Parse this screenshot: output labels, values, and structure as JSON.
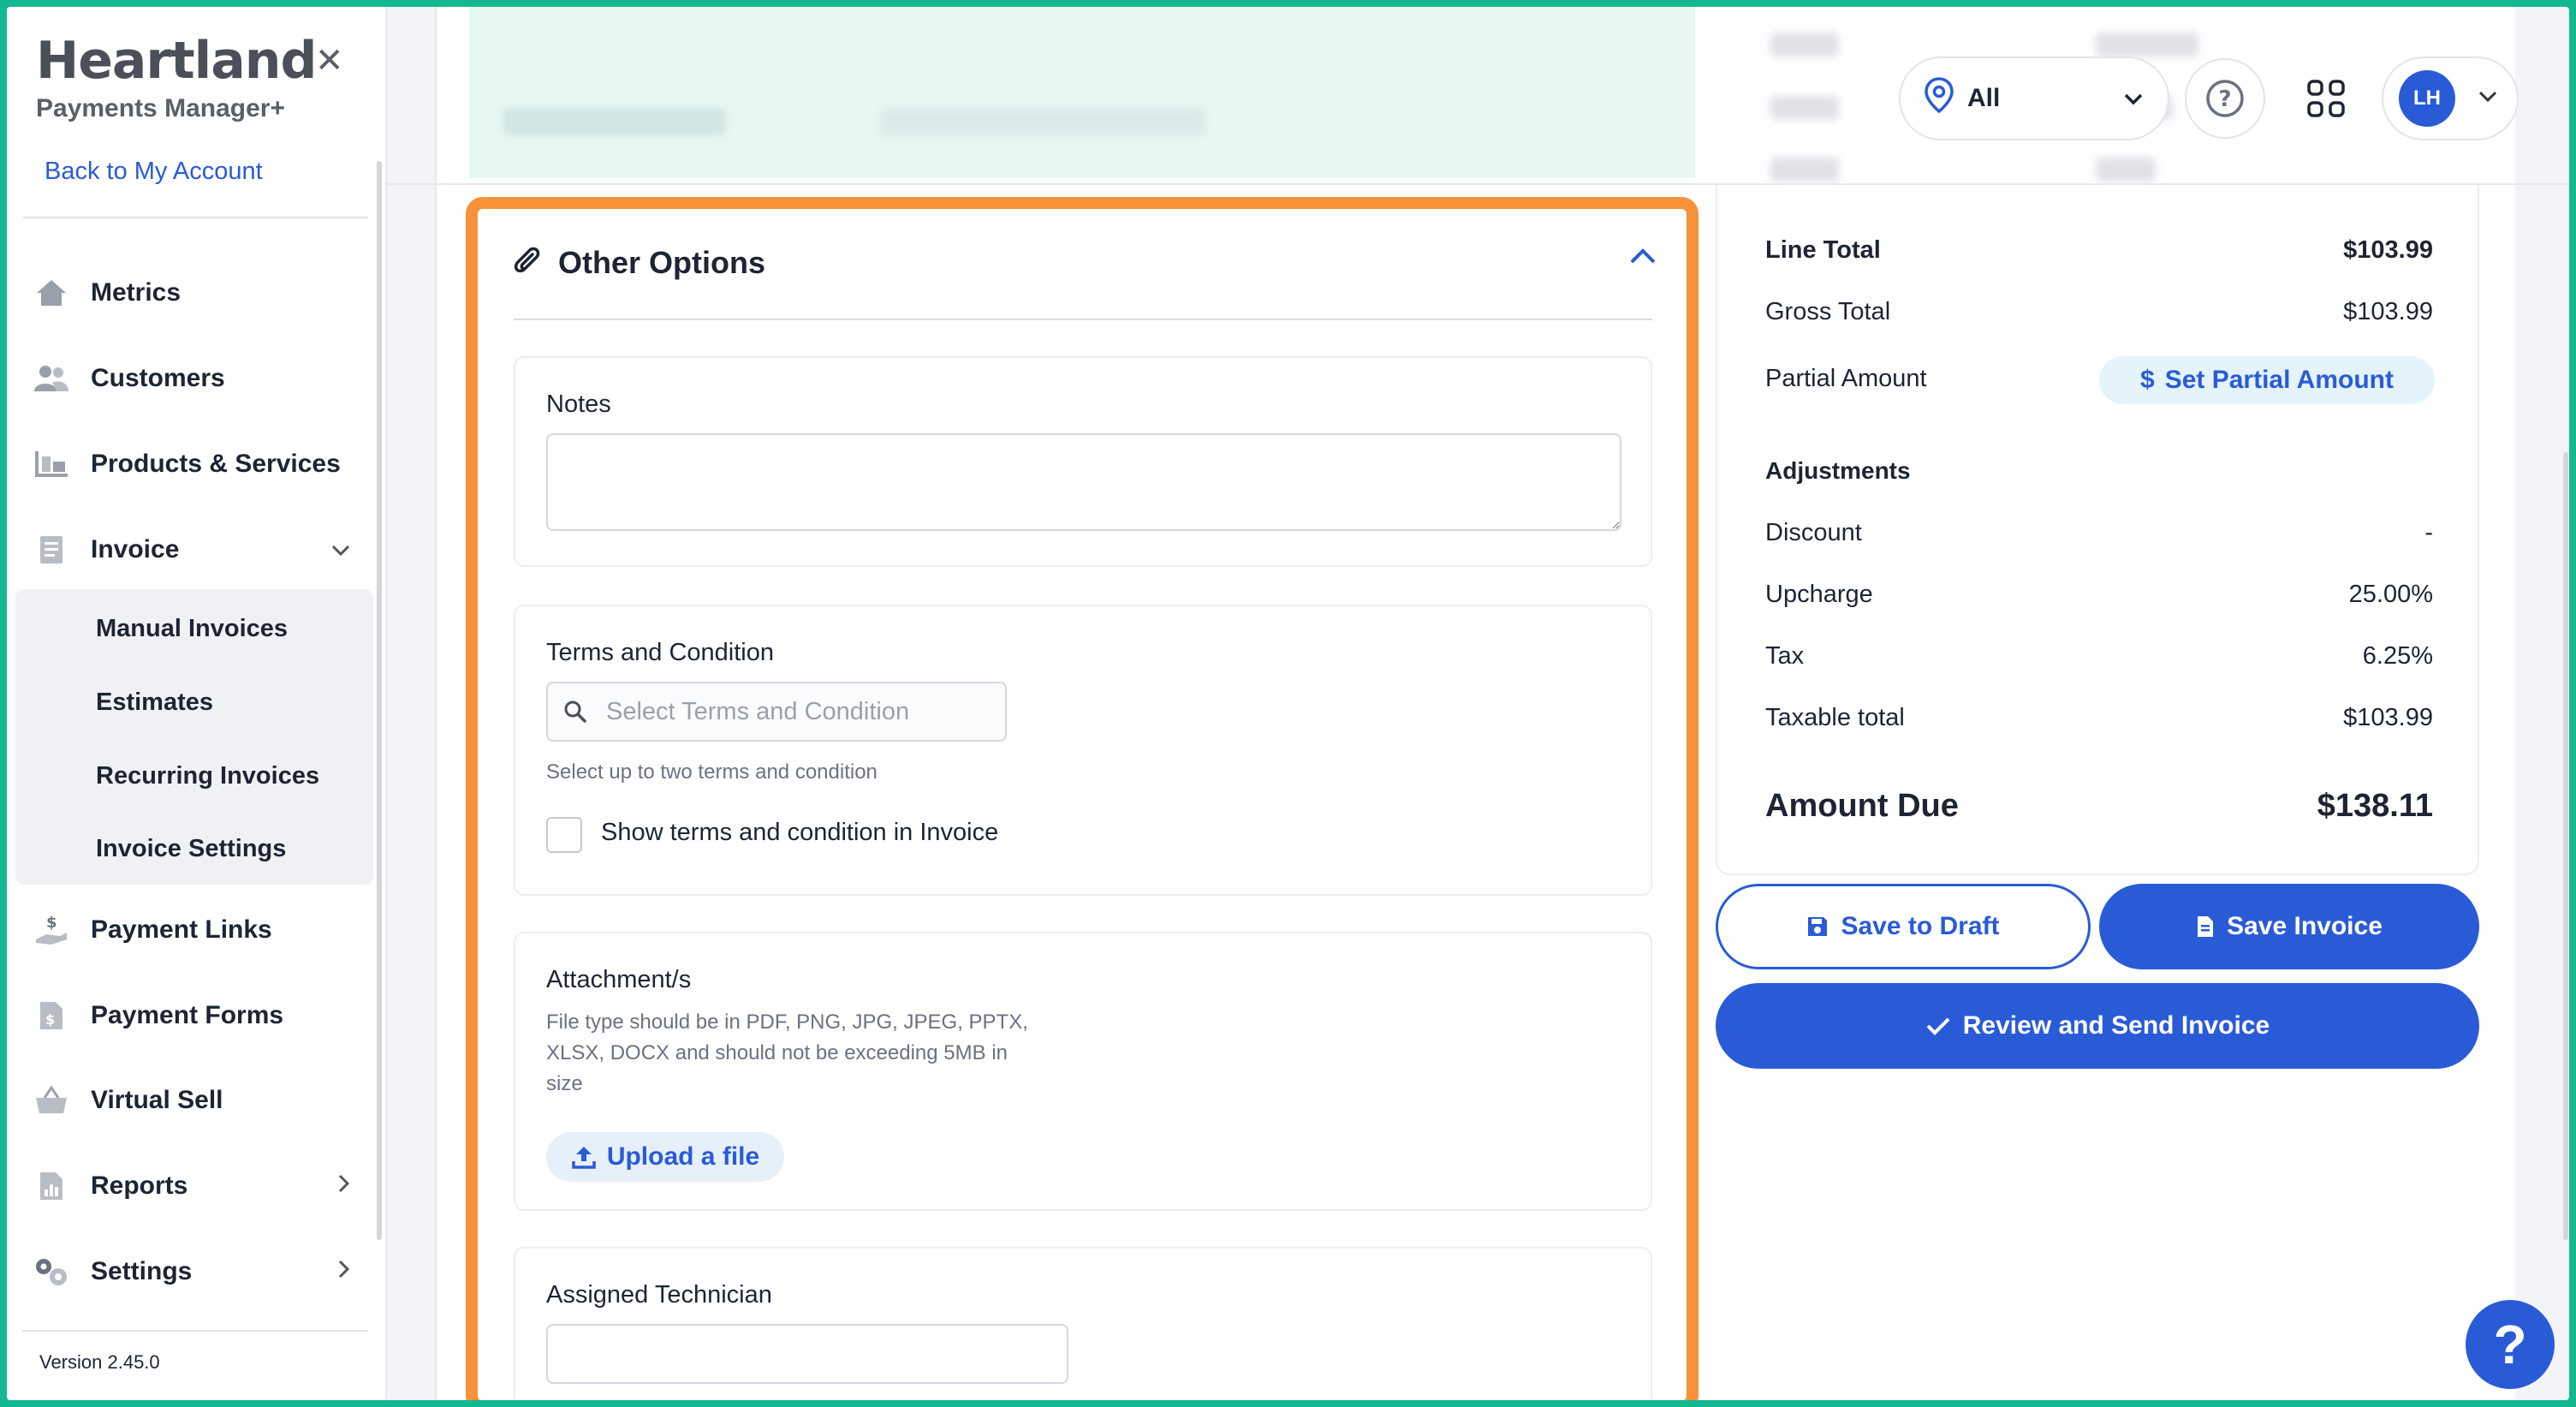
{
  "sidebar": {
    "brand": "Heartland",
    "brand_sub": "Payments Manager+",
    "back_link": "Back to My Account",
    "nav": [
      {
        "label": "Metrics"
      },
      {
        "label": "Customers"
      },
      {
        "label": "Products & Services"
      },
      {
        "label": "Invoice"
      },
      {
        "label": "Payment Links"
      },
      {
        "label": "Payment Forms"
      },
      {
        "label": "Virtual Sell"
      },
      {
        "label": "Reports"
      },
      {
        "label": "Settings"
      }
    ],
    "invoice_submenu": [
      {
        "label": "Manual Invoices"
      },
      {
        "label": "Estimates"
      },
      {
        "label": "Recurring Invoices"
      },
      {
        "label": "Invoice Settings"
      }
    ],
    "version": "Version 2.45.0"
  },
  "header": {
    "location_value": "All",
    "avatar_initials": "LH"
  },
  "other_options": {
    "title": "Other Options",
    "notes_label": "Notes",
    "notes_value": "",
    "terms_label": "Terms and Condition",
    "terms_placeholder": "Select Terms and Condition",
    "terms_hint": "Select up to two terms and condition",
    "terms_checkbox_label": "Show terms and condition in Invoice",
    "attachments_label": "Attachment/s",
    "attachments_hint_line1": "File type should be in PDF, PNG, JPG, JPEG, PPTX,",
    "attachments_hint_line2": "XLSX, DOCX and should not be exceeding 5MB in",
    "attachments_hint_line3": "size",
    "upload_label": "Upload a file",
    "technician_label": "Assigned Technician",
    "technician_value": ""
  },
  "summary": {
    "line_total_label": "Line Total",
    "line_total_value": "$103.99",
    "gross_total_label": "Gross Total",
    "gross_total_value": "$103.99",
    "partial_label": "Partial Amount",
    "partial_button": "Set Partial Amount",
    "adjustments_heading": "Adjustments",
    "discount_label": "Discount",
    "discount_value": "-",
    "upcharge_label": "Upcharge",
    "upcharge_value": "25.00%",
    "tax_label": "Tax",
    "tax_value": "6.25%",
    "taxable_label": "Taxable total",
    "taxable_value": "$103.99",
    "amount_due_label": "Amount Due",
    "amount_due_value": "$138.11"
  },
  "actions": {
    "save_draft": "Save to Draft",
    "save_invoice": "Save Invoice",
    "review_send": "Review and Send Invoice"
  },
  "help_fab": "?",
  "colors": {
    "accent": "#2a5bd7",
    "highlight": "#f7913a",
    "frame": "#14b890"
  }
}
